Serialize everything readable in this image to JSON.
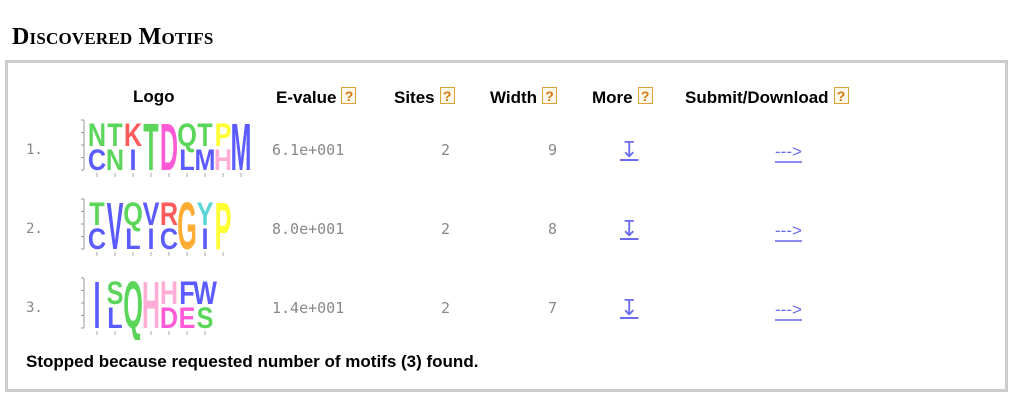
{
  "section_title": "Discovered Motifs",
  "headers": {
    "logo": "Logo",
    "evalue": "E-value",
    "sites": "Sites",
    "width": "Width",
    "more": "More",
    "submit": "Submit/Download",
    "help_glyph": "?"
  },
  "motifs": [
    {
      "num": "1.",
      "evalue": "6.1e+001",
      "sites": "2",
      "width": "9",
      "more_glyph": "↧",
      "submit_glyph": "--->",
      "logo_letters": [
        {
          "top": "N",
          "bottom": "C",
          "top_color": "#33cc33",
          "bottom_color": "#3333ff"
        },
        {
          "top": "T",
          "bottom": "N",
          "top_color": "#33cc33",
          "bottom_color": "#33cc33"
        },
        {
          "top": "K",
          "bottom": "I",
          "top_color": "#ff3333",
          "bottom_color": "#3333ff"
        },
        {
          "top": "T",
          "bottom": "",
          "top_color": "#33cc33",
          "bottom_color": ""
        },
        {
          "top": "D",
          "bottom": "",
          "top_color": "#ff33cc",
          "bottom_color": ""
        },
        {
          "top": "Q",
          "bottom": "L",
          "top_color": "#33cc33",
          "bottom_color": "#3333ff"
        },
        {
          "top": "T",
          "bottom": "M",
          "top_color": "#33cc33",
          "bottom_color": "#3333ff"
        },
        {
          "top": "P",
          "bottom": "H",
          "top_color": "#ffff00",
          "bottom_color": "#ff99cc"
        },
        {
          "top": "M",
          "bottom": "",
          "top_color": "#3333ff",
          "bottom_color": ""
        }
      ]
    },
    {
      "num": "2.",
      "evalue": "8.0e+001",
      "sites": "2",
      "width": "8",
      "more_glyph": "↧",
      "submit_glyph": "--->",
      "logo_letters": [
        {
          "top": "T",
          "bottom": "C",
          "top_color": "#33cc33",
          "bottom_color": "#3333ff"
        },
        {
          "top": "V",
          "bottom": "",
          "top_color": "#3333ff",
          "bottom_color": ""
        },
        {
          "top": "Q",
          "bottom": "L",
          "top_color": "#33cc33",
          "bottom_color": "#3333ff"
        },
        {
          "top": "V",
          "bottom": "I",
          "top_color": "#3333ff",
          "bottom_color": "#3333ff"
        },
        {
          "top": "R",
          "bottom": "C",
          "top_color": "#ff3333",
          "bottom_color": "#3333ff"
        },
        {
          "top": "G",
          "bottom": "",
          "top_color": "#ff9900",
          "bottom_color": ""
        },
        {
          "top": "Y",
          "bottom": "I",
          "top_color": "#33cccc",
          "bottom_color": "#3333ff"
        },
        {
          "top": "P",
          "bottom": "",
          "top_color": "#ffff00",
          "bottom_color": ""
        }
      ]
    },
    {
      "num": "3.",
      "evalue": "1.4e+001",
      "sites": "2",
      "width": "7",
      "more_glyph": "↧",
      "submit_glyph": "--->",
      "logo_letters": [
        {
          "top": "I",
          "bottom": "",
          "top_color": "#3333ff",
          "bottom_color": ""
        },
        {
          "top": "S",
          "bottom": "L",
          "top_color": "#33cc33",
          "bottom_color": "#3333ff"
        },
        {
          "top": "Q",
          "bottom": "",
          "top_color": "#33cc33",
          "bottom_color": ""
        },
        {
          "top": "H",
          "bottom": "",
          "top_color": "#ff99cc",
          "bottom_color": ""
        },
        {
          "top": "H",
          "bottom": "D",
          "top_color": "#ff99cc",
          "bottom_color": "#ff33cc"
        },
        {
          "top": "F",
          "bottom": "E",
          "top_color": "#3333ff",
          "bottom_color": "#ff33cc"
        },
        {
          "top": "W",
          "bottom": "S",
          "top_color": "#3333ff",
          "bottom_color": "#33cc33"
        }
      ]
    }
  ],
  "footer_text": "Stopped because requested number of motifs (3) found."
}
